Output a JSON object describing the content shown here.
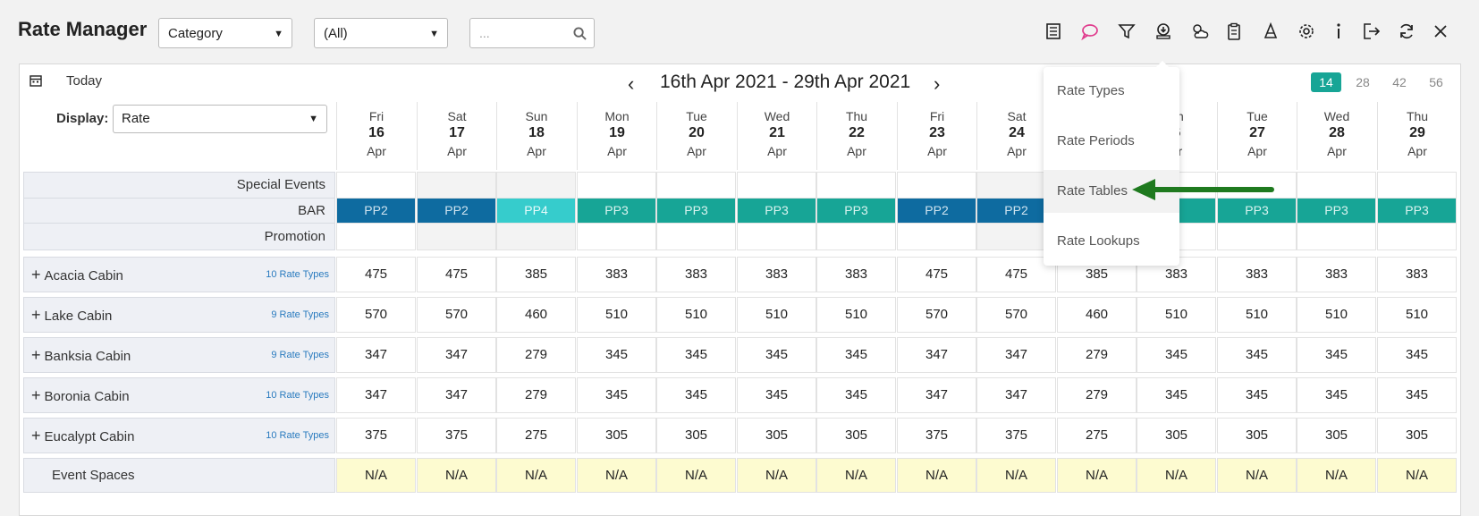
{
  "app": {
    "title": "Rate Manager"
  },
  "filters": {
    "category": "Category",
    "area": "(All)",
    "search_placeholder": "..."
  },
  "toolbar_icons": [
    "list-icon",
    "chat-icon",
    "filter-icon",
    "download-icon",
    "weather-icon",
    "clipboard-icon",
    "rocket-icon",
    "gear-icon",
    "info-icon",
    "exit-icon",
    "refresh-icon",
    "close-icon"
  ],
  "nav": {
    "today": "Today",
    "date_range": "16th Apr 2021 - 29th Apr 2021",
    "prev": "‹",
    "next": "›",
    "ranges": [
      "14",
      "28",
      "42",
      "56"
    ],
    "active_range": "14"
  },
  "display": {
    "label": "Display:",
    "value": "Rate"
  },
  "days": [
    {
      "dow": "Fri",
      "num": "16",
      "mon": "Apr"
    },
    {
      "dow": "Sat",
      "num": "17",
      "mon": "Apr"
    },
    {
      "dow": "Sun",
      "num": "18",
      "mon": "Apr"
    },
    {
      "dow": "Mon",
      "num": "19",
      "mon": "Apr"
    },
    {
      "dow": "Tue",
      "num": "20",
      "mon": "Apr"
    },
    {
      "dow": "Wed",
      "num": "21",
      "mon": "Apr"
    },
    {
      "dow": "Thu",
      "num": "22",
      "mon": "Apr"
    },
    {
      "dow": "Fri",
      "num": "23",
      "mon": "Apr"
    },
    {
      "dow": "Sat",
      "num": "24",
      "mon": "Apr"
    },
    {
      "dow": "",
      "num": "",
      "mon": ""
    },
    {
      "dow": "on",
      "num": "6",
      "mon": "or"
    },
    {
      "dow": "Tue",
      "num": "27",
      "mon": "Apr"
    },
    {
      "dow": "Wed",
      "num": "28",
      "mon": "Apr"
    },
    {
      "dow": "Thu",
      "num": "29",
      "mon": "Apr"
    }
  ],
  "special_events_label": "Special Events",
  "bar": {
    "label": "BAR",
    "values": [
      "PP2",
      "PP2",
      "PP4",
      "PP3",
      "PP3",
      "PP3",
      "PP3",
      "PP2",
      "PP2",
      "",
      "3",
      "PP3",
      "PP3",
      "PP3"
    ]
  },
  "promotion_label": "Promotion",
  "cabins": [
    {
      "name": "Acacia Cabin",
      "rate_types": "10 Rate Types",
      "rates": [
        "475",
        "475",
        "385",
        "383",
        "383",
        "383",
        "383",
        "475",
        "475",
        "385",
        "383",
        "383",
        "383",
        "383"
      ]
    },
    {
      "name": "Lake Cabin",
      "rate_types": "9 Rate Types",
      "rates": [
        "570",
        "570",
        "460",
        "510",
        "510",
        "510",
        "510",
        "570",
        "570",
        "460",
        "510",
        "510",
        "510",
        "510"
      ]
    },
    {
      "name": "Banksia Cabin",
      "rate_types": "9 Rate Types",
      "rates": [
        "347",
        "347",
        "279",
        "345",
        "345",
        "345",
        "345",
        "347",
        "347",
        "279",
        "345",
        "345",
        "345",
        "345"
      ]
    },
    {
      "name": "Boronia Cabin",
      "rate_types": "10 Rate Types",
      "rates": [
        "347",
        "347",
        "279",
        "345",
        "345",
        "345",
        "345",
        "347",
        "347",
        "279",
        "345",
        "345",
        "345",
        "345"
      ]
    },
    {
      "name": "Eucalypt Cabin",
      "rate_types": "10 Rate Types",
      "rates": [
        "375",
        "375",
        "275",
        "305",
        "305",
        "305",
        "305",
        "375",
        "375",
        "275",
        "305",
        "305",
        "305",
        "305"
      ]
    }
  ],
  "event_spaces": {
    "name": "Event Spaces",
    "values": [
      "N/A",
      "N/A",
      "N/A",
      "N/A",
      "N/A",
      "N/A",
      "N/A",
      "N/A",
      "N/A",
      "N/A",
      "N/A",
      "N/A",
      "N/A",
      "N/A"
    ]
  },
  "dropdown": {
    "items": [
      "Rate Types",
      "Rate Periods",
      "Rate Tables",
      "Rate Lookups"
    ],
    "highlighted": "Rate Tables"
  },
  "colors": {
    "pp2": "#0e6ba0",
    "pp3": "#17a596",
    "pp4": "#36cccc",
    "na_bg": "#fdfbd0",
    "active_range": "#17a596",
    "arrow": "#1f7a1f",
    "chat_icon": "#e03a8c"
  }
}
